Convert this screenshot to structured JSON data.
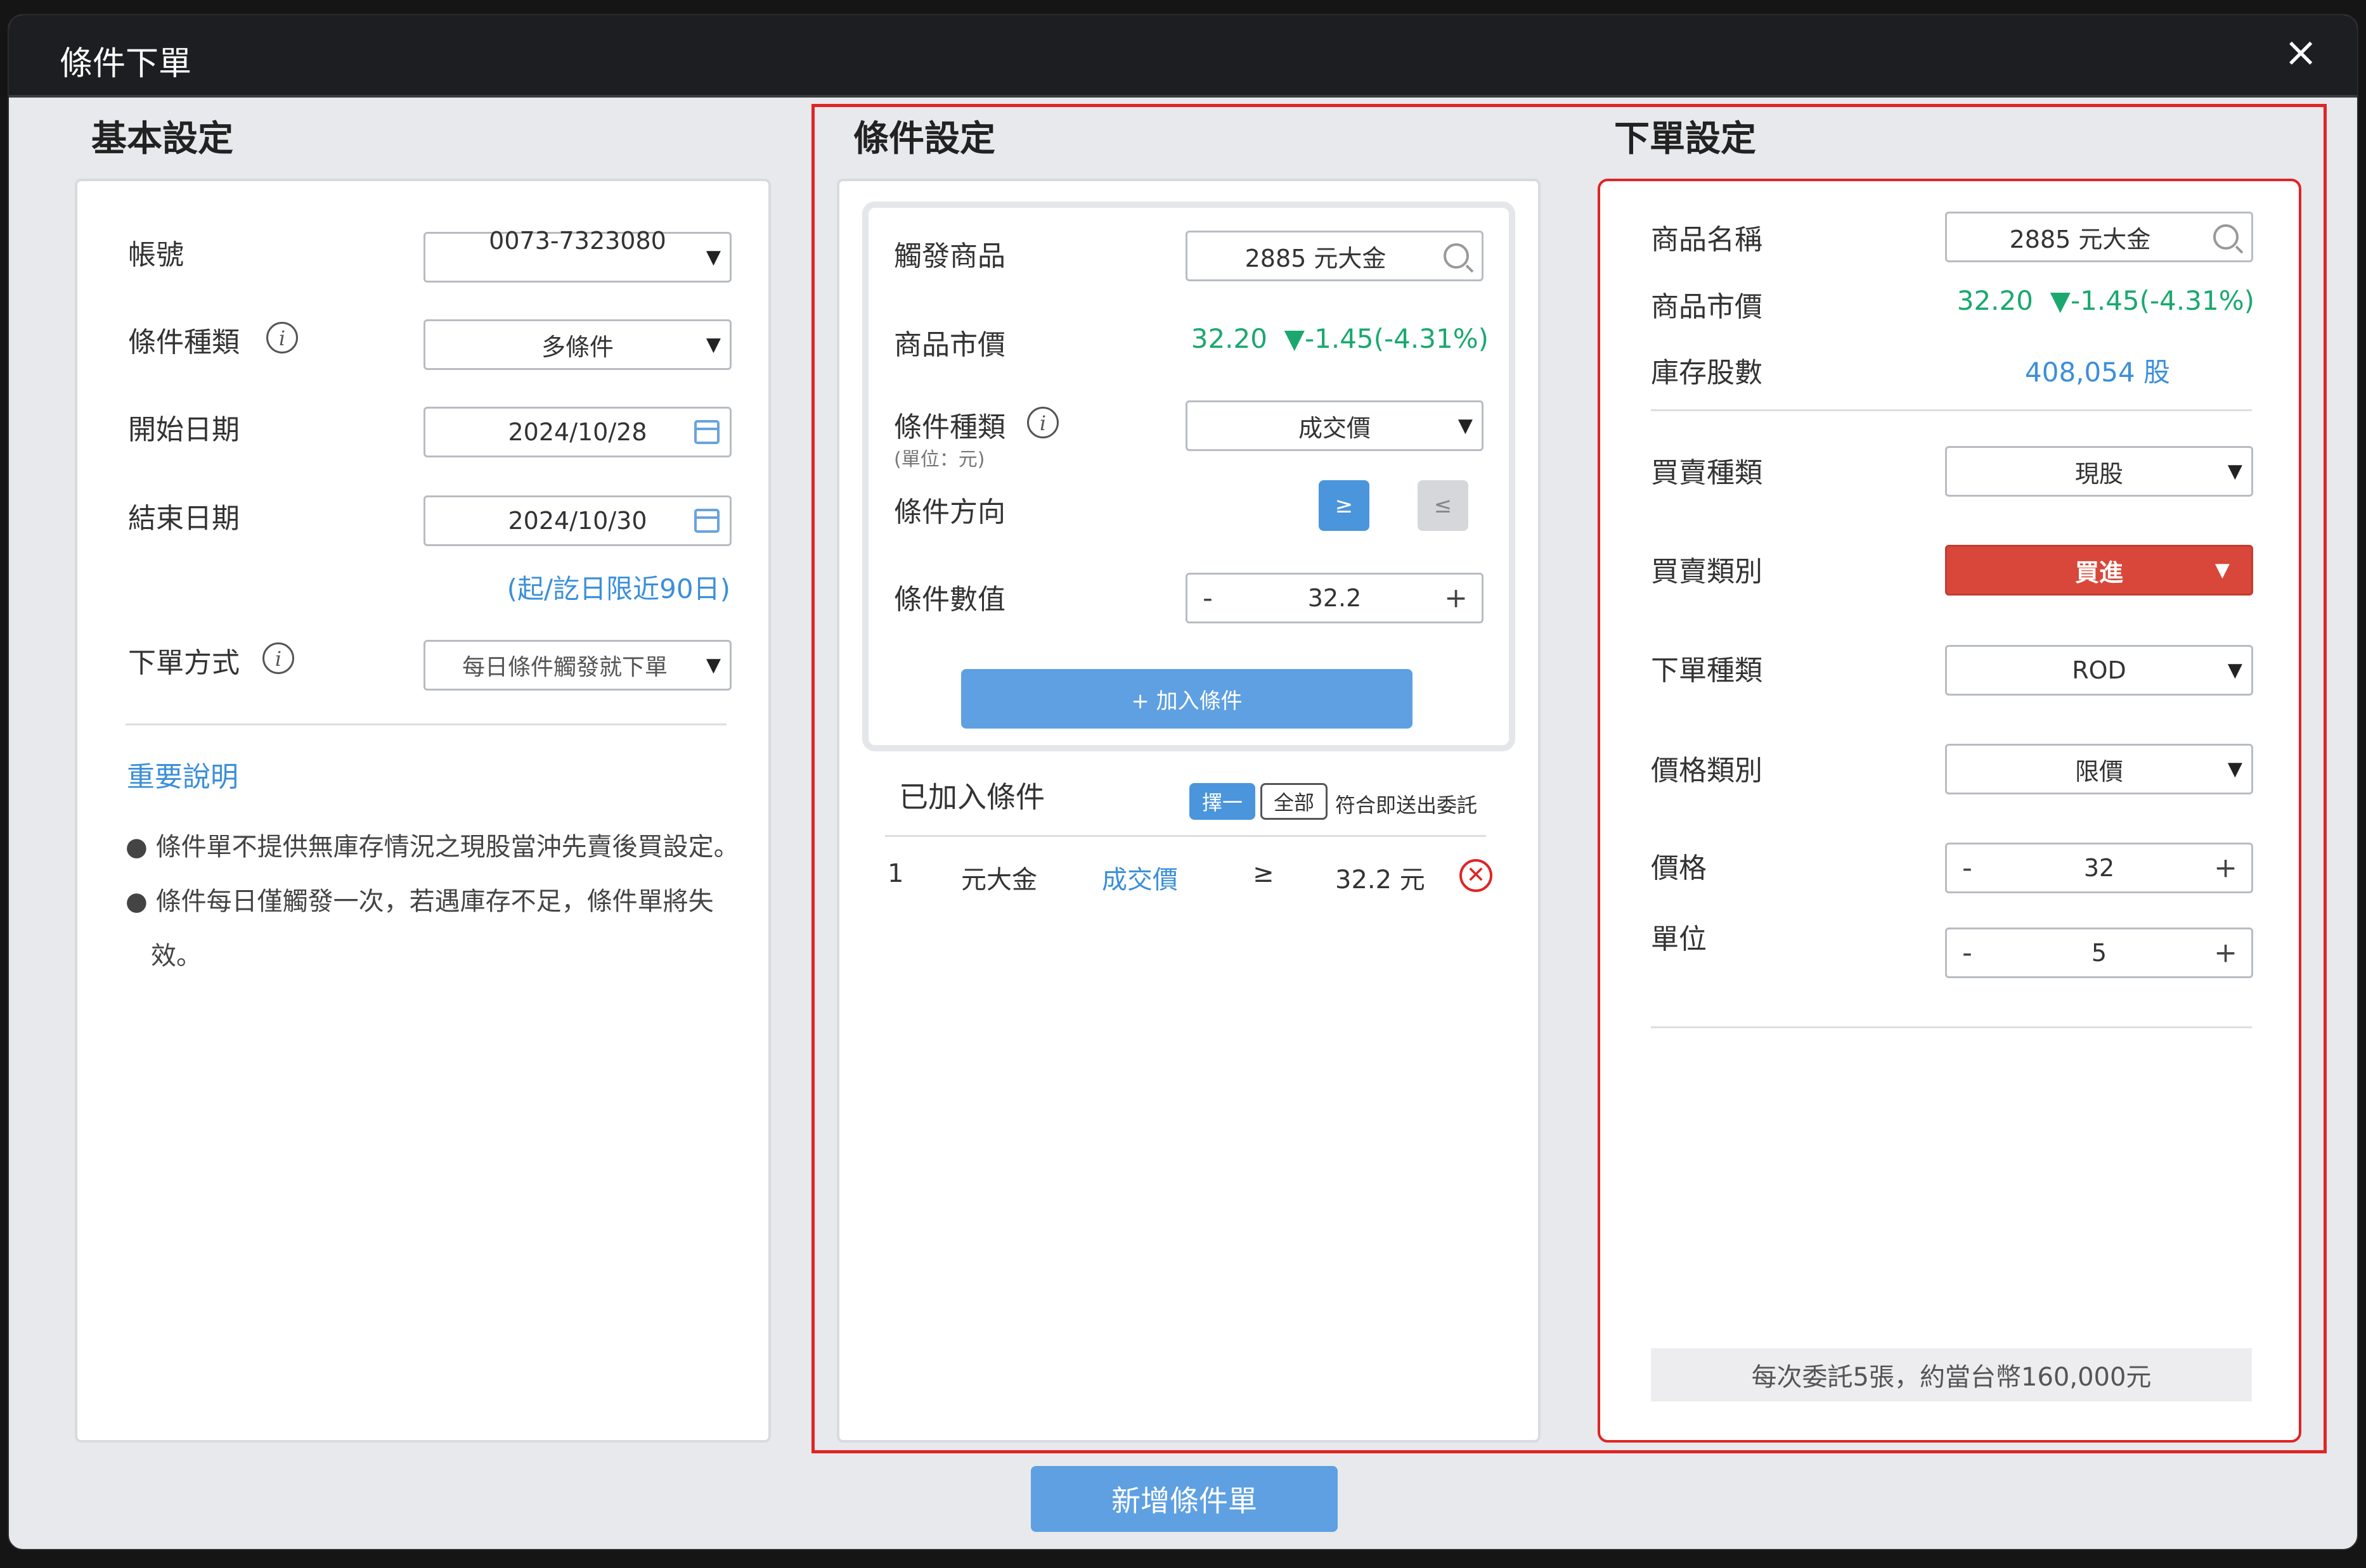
{
  "dialog": {
    "title": "條件下單",
    "close_symbol": "×"
  },
  "basic": {
    "title": "基本設定",
    "account_label": "帳號",
    "account_value": "0073-7323080",
    "cond_type_label": "條件種類",
    "cond_type_value": "多條件",
    "start_label": "開始日期",
    "start_value": "2024/10/28",
    "end_label": "結束日期",
    "end_value": "2024/10/30",
    "date_limit_note": "(起/訖日限近90日)",
    "order_mode_label": "下單方式",
    "order_mode_value": "每日條件觸發就下單",
    "important_link": "重要說明",
    "notes": [
      "條件單不提供無庫存情況之現股當沖先賣後買設定。",
      "條件每日僅觸發一次，若遇庫存不足，條件單將失",
      "效。"
    ]
  },
  "condition": {
    "title": "條件設定",
    "trigger_label": "觸發商品",
    "trigger_value": "2885 元大金",
    "price_label": "商品市價",
    "price": "32.20",
    "change": "▼-1.45(-4.31%)",
    "cond_kind_label": "條件種類",
    "cond_kind_unit": "(單位：元)",
    "cond_kind_value": "成交價",
    "direction_label": "條件方向",
    "dir_ge": "≥",
    "dir_le": "≤",
    "value_label": "條件數值",
    "value": "32.2",
    "minus": "-",
    "plus": "+",
    "add_button": "+ 加入條件",
    "added_title": "已加入條件",
    "mode_one": "擇一",
    "mode_all": "全部",
    "mode_note": "符合即送出委託",
    "rows": [
      {
        "idx": "1",
        "product": "元大金",
        "kind": "成交價",
        "op": "≥",
        "val": "32.2 元"
      }
    ]
  },
  "order": {
    "title": "下單設定",
    "name_label": "商品名稱",
    "name_value": "2885 元大金",
    "price_label": "商品市價",
    "price": "32.20",
    "change": "▼-1.45(-4.31%)",
    "stock_label": "庫存股數",
    "stock_value": "408,054 股",
    "trade_type_label": "買賣種類",
    "trade_type_value": "現股",
    "side_label": "買賣類別",
    "side_value": "買進",
    "order_type_label": "下單種類",
    "order_type_value": "ROD",
    "price_type_label": "價格類別",
    "price_type_value": "限價",
    "limit_price_label": "價格",
    "limit_price_value": "32",
    "unit_label": "單位",
    "unit_value": "5",
    "summary": "每次委託5張，約當台幣160,000元"
  },
  "footer": {
    "submit": "新增條件單"
  },
  "colors": {
    "accent": "#5ea0e2",
    "up_down_green": "#1aa86f",
    "buy_red": "#d8473a",
    "highlight_border": "#e02424"
  }
}
